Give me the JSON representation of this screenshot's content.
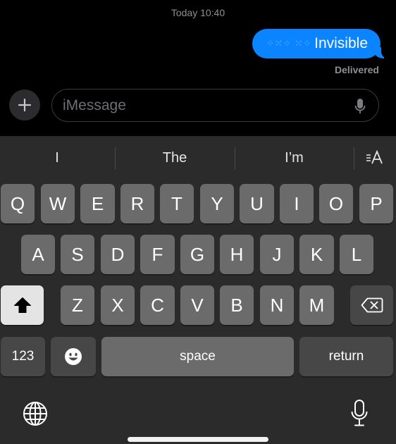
{
  "conversation": {
    "timestamp": "Today 10:40",
    "bubble_effect": "⁘⁙⁘ ⁙⁘",
    "message_text": "Invisible",
    "delivered": "Delivered",
    "bubble_color": "#0a84ff"
  },
  "input_bar": {
    "plus_icon": "plus-icon",
    "placeholder": "iMessage",
    "mic_icon": "microphone-icon"
  },
  "predictive": {
    "suggestions": [
      "I",
      "The",
      "I’m"
    ],
    "format_icon": "text-format-icon"
  },
  "keyboard": {
    "row1": [
      "Q",
      "W",
      "E",
      "R",
      "T",
      "Y",
      "U",
      "I",
      "O",
      "P"
    ],
    "row2": [
      "A",
      "S",
      "D",
      "F",
      "G",
      "H",
      "J",
      "K",
      "L"
    ],
    "row3": [
      "Z",
      "X",
      "C",
      "V",
      "B",
      "N",
      "M"
    ],
    "numbers_key": "123",
    "emoji_icon": "emoji-icon",
    "space_label": "space",
    "return_label": "return",
    "shift_icon": "shift-icon",
    "delete_icon": "delete-icon",
    "globe_icon": "globe-icon",
    "dictation_icon": "microphone-icon"
  }
}
